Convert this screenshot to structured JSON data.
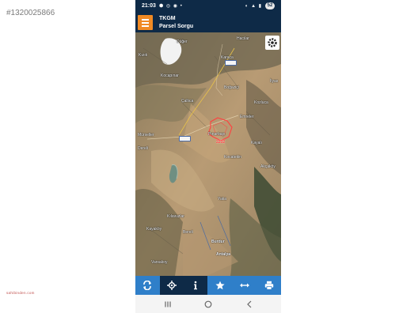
{
  "listing": {
    "id": "#1320025866",
    "watermark": "sahibinden.com"
  },
  "status_bar": {
    "time": "21:03",
    "notification_icons": "⬢ ◎ ◉ •",
    "system_icons": "◐ ▲ ▮",
    "battery": "52"
  },
  "header": {
    "title": "TKGM",
    "subtitle": "Parsel Sorgu"
  },
  "map": {
    "places": [
      "Kızık",
      "Düğer",
      "Hacılar",
      "Karaca",
      "Kocapınar",
      "Boğaziçi",
      "İlyas",
      "Çallıca",
      "Kozluca",
      "Emreler",
      "Mürseller",
      "Pınarbaşı",
      "Kayalı",
      "Dereli",
      "Kocatekin",
      "Akçaköy",
      "Yaka",
      "Kılavuzlar",
      "Kayaköy",
      "Bereli",
      "Varsakoy",
      "Burdur",
      "Antalya"
    ],
    "road_numbers": [
      "",
      ""
    ],
    "parcel_number": "2232"
  },
  "toolbar": {
    "buttons": [
      "refresh",
      "locate",
      "info",
      "favorite",
      "measure",
      "print"
    ]
  },
  "colors": {
    "header": "#0e2a47",
    "menu_button": "#f08a24",
    "toolbar": "#2f7fc9",
    "toolbar_active": "#0e2a47",
    "parcel": "#ff4040"
  }
}
